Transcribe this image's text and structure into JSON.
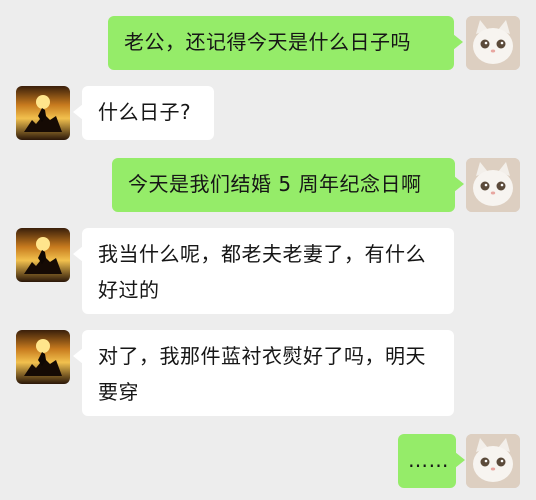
{
  "messages": [
    {
      "side": "me",
      "text": "老公，还记得今天是什么日子吗",
      "avatar": "cat-avatar"
    },
    {
      "side": "other",
      "text": "什么日子?",
      "avatar": "horse-sunset-avatar"
    },
    {
      "side": "me",
      "text": "今天是我们结婚 5 周年纪念日啊",
      "avatar": "cat-avatar"
    },
    {
      "side": "other",
      "text": "我当什么呢，都老夫老妻了，有什么好过的",
      "avatar": "horse-sunset-avatar"
    },
    {
      "side": "other",
      "text": "对了，我那件蓝衬衣熨好了吗，明天要穿",
      "avatar": "horse-sunset-avatar"
    },
    {
      "side": "me",
      "text": "……",
      "avatar": "cat-avatar"
    }
  ],
  "colors": {
    "background": "#ededed",
    "my_bubble": "#95ec69",
    "other_bubble": "#ffffff"
  }
}
